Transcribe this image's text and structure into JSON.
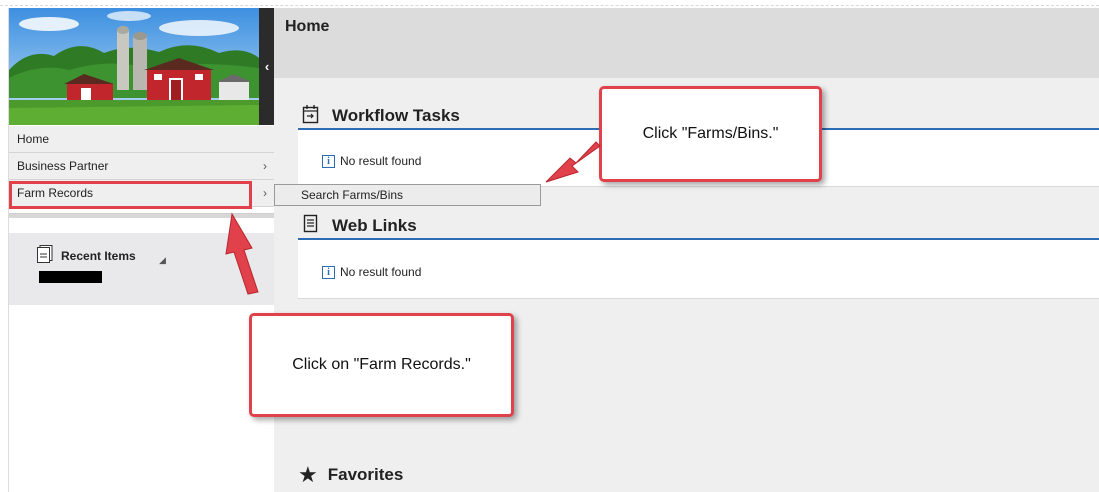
{
  "app": {
    "page_title": "Home"
  },
  "sidebar": {
    "collapse_glyph": "‹",
    "items": [
      {
        "label": "Home",
        "has_submenu": false
      },
      {
        "label": "Business Partner",
        "has_submenu": true,
        "chevron": "›"
      },
      {
        "label": "Farm Records",
        "has_submenu": true,
        "chevron": "›"
      }
    ],
    "recent": {
      "label": "Recent Items",
      "icon": "document-icon",
      "caret": "◢"
    }
  },
  "flyout": {
    "label": "Search Farms/Bins"
  },
  "sections": {
    "workflow": {
      "title": "Workflow Tasks",
      "icon": "calendar-icon",
      "empty_text": "No result found"
    },
    "weblinks": {
      "title": "Web Links",
      "icon": "document-icon",
      "empty_text": "No result found"
    },
    "favorites": {
      "title": "Favorites",
      "icon": "star-icon",
      "glyph": "★"
    }
  },
  "info_glyph": "i",
  "callouts": {
    "farms_bins": "Click \"Farms/Bins.\"",
    "farm_records": "Click on \"Farm Records.\""
  },
  "colors": {
    "accent": "#2c6cb4",
    "callout_red": "#e0414a",
    "header_gray": "#dcdcdc"
  }
}
